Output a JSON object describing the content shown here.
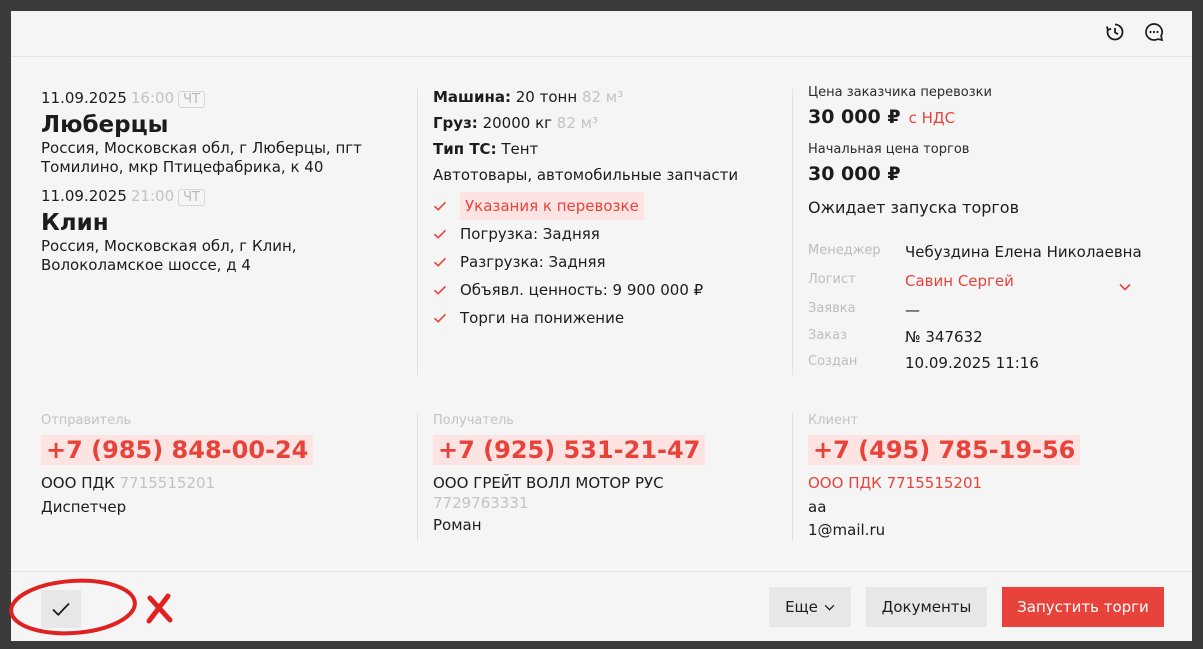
{
  "header": {
    "history_icon": "history-icon",
    "chat_icon": "chat-icon"
  },
  "route": {
    "from": {
      "date": "11.09.2025",
      "time": "16:00",
      "dow": "ЧТ",
      "city": "Люберцы",
      "address": "Россия, Московская обл, г Люберцы, пгт Томилино, мкр Птицефабрика, к 40"
    },
    "to": {
      "date": "11.09.2025",
      "time": "21:00",
      "dow": "ЧТ",
      "city": "Клин",
      "address": "Россия, Московская обл, г Клин, Волоколамское шоссе, д 4"
    }
  },
  "cargo": {
    "machine_label": "Машина:",
    "machine_value": "20 тонн",
    "machine_volume": "82 м³",
    "load_label": "Груз:",
    "load_value": "20000 кг",
    "load_volume": "82 м³",
    "ts_label": "Тип ТС:",
    "ts_value": "Тент",
    "goods": "Автотовары, автомобильные запчасти",
    "checks": [
      "Указания к перевозке",
      "Погрузка: Задняя",
      "Разгрузка: Задняя",
      "Объявл. ценность: 9 900 000 ₽",
      "Торги на понижение"
    ]
  },
  "pricing": {
    "customer_price_label": "Цена заказчика перевозки",
    "customer_price": "30 000 ₽",
    "vat": "с НДС",
    "start_price_label": "Начальная цена торгов",
    "start_price": "30 000 ₽",
    "status": "Ожидает запуска торгов",
    "meta": [
      {
        "key": "Менеджер",
        "value": "Чебуздина Елена Николаевна"
      },
      {
        "key": "Логист",
        "value": "Савин Сергей"
      },
      {
        "key": "Заявка",
        "value": "—"
      },
      {
        "key": "Заказ",
        "value": "№ 347632"
      },
      {
        "key": "Создан",
        "value": "10.09.2025 11:16"
      }
    ]
  },
  "contacts": {
    "sender": {
      "label": "Отправитель",
      "phone": "+7 (985) 848-00-24",
      "company": "ООО ПДК",
      "inn": "7715515201",
      "role": "Диспетчер"
    },
    "receiver": {
      "label": "Получатель",
      "phone": "+7 (925) 531-21-47",
      "company": "ООО ГРЕЙТ ВОЛЛ МОТОР РУС",
      "inn": "7729763331",
      "person": "Роман"
    },
    "client": {
      "label": "Клиент",
      "phone": "+7 (495) 785-19-56",
      "company": "ООО ПДК",
      "inn": "7715515201",
      "line1": "аа",
      "email": "1@mail.ru"
    }
  },
  "footer": {
    "more": "Еще",
    "documents": "Документы",
    "start": "Запустить торги"
  },
  "colors": {
    "accent": "#e8433b",
    "accent_bg": "#fde4e2",
    "card": "#f5f5f5",
    "overlay": "#3a3a3a"
  }
}
